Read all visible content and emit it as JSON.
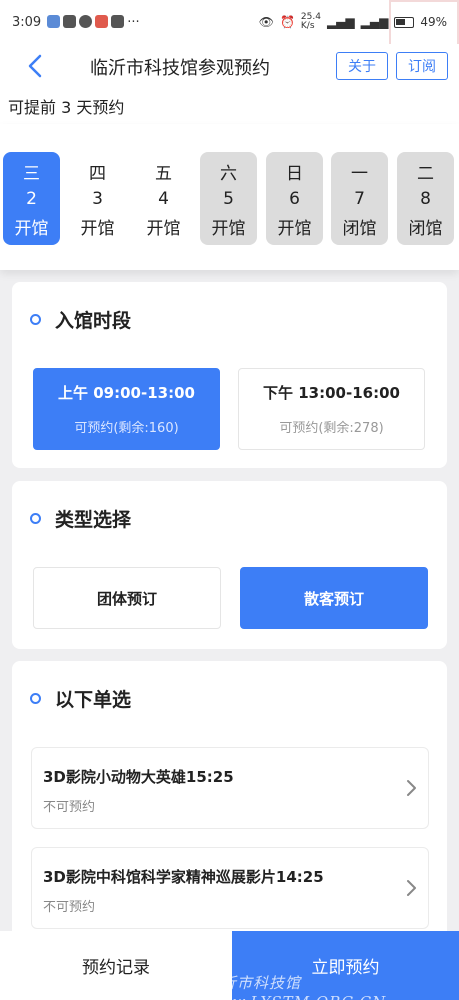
{
  "status_bar": {
    "time": "3:09",
    "net_speed": "25.4\nK/s",
    "battery": "49%"
  },
  "nav": {
    "title": "临沂市科技馆参观预约",
    "about_label": "关于",
    "subscribe_label": "订阅"
  },
  "advance_note": "可提前 3 天预约",
  "dates": [
    {
      "weekday": "三",
      "day": "2",
      "status": "开馆"
    },
    {
      "weekday": "四",
      "day": "3",
      "status": "开馆"
    },
    {
      "weekday": "五",
      "day": "4",
      "status": "开馆"
    },
    {
      "weekday": "六",
      "day": "5",
      "status": "开馆"
    },
    {
      "weekday": "日",
      "day": "6",
      "status": "开馆"
    },
    {
      "weekday": "一",
      "day": "7",
      "status": "闭馆"
    },
    {
      "weekday": "二",
      "day": "8",
      "status": "闭馆"
    }
  ],
  "time_section": {
    "title": "入馆时段",
    "slots": [
      {
        "time": "上午 09:00-13:00",
        "availability": "可预约(剩余:160)"
      },
      {
        "time": "下午 13:00-16:00",
        "availability": "可预约(剩余:278)"
      }
    ]
  },
  "type_section": {
    "title": "类型选择",
    "options": [
      {
        "label": "团体预订"
      },
      {
        "label": "散客预订"
      }
    ]
  },
  "list_section": {
    "title": "以下单选",
    "items": [
      {
        "title": "3D影院小动物大英雄15:25",
        "status": "不可预约"
      },
      {
        "title": "3D影院中科馆科学家精神巡展影片14:25",
        "status": "不可预约"
      }
    ]
  },
  "bottom": {
    "records_label": "预约记录",
    "book_label": "立即预约"
  },
  "watermark": "临沂市科技馆 www.LYSTM.ORG.CN",
  "colors": {
    "accent": "#3d7ef6",
    "closed_bg": "#dcdcdc",
    "page_bg": "#efeff1"
  }
}
